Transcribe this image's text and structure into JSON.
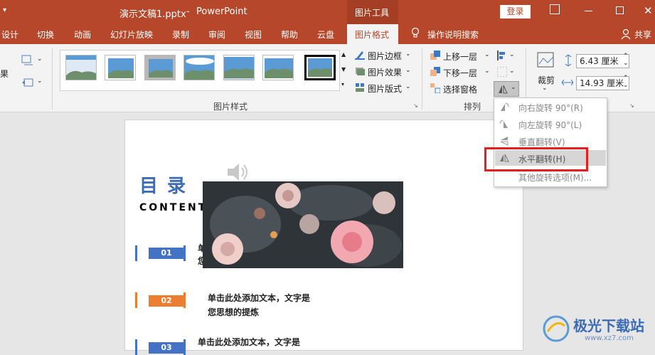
{
  "titlebar": {
    "filename": "演示文稿1.pptx",
    "separator": "-",
    "app": "PowerPoint",
    "context_tab": "图片工具",
    "login": "登录"
  },
  "tabs": [
    "设计",
    "切换",
    "动画",
    "幻灯片放映",
    "录制",
    "审阅",
    "视图",
    "帮助",
    "云盘",
    "图片格式"
  ],
  "tell_me": "操作说明搜索",
  "share": "共享",
  "ribbon": {
    "left_partial": "果",
    "picture_border": "图片边框",
    "picture_effects": "图片效果",
    "picture_layout": "图片版式",
    "styles_group": "图片样式",
    "bring_forward": "上移一层",
    "send_backward": "下移一层",
    "selection_pane": "选择窗格",
    "arrange_group": "排列",
    "crop": "裁剪",
    "height": "6.43 厘米",
    "width": "14.93 厘米"
  },
  "rotate_menu": {
    "items": [
      {
        "label": "向右旋转 90°(R)",
        "icon": "rotate-right-icon"
      },
      {
        "label": "向左旋转 90°(L)",
        "icon": "rotate-left-icon"
      },
      {
        "label": "垂直翻转(V)",
        "icon": "flip-vertical-icon"
      },
      {
        "label": "水平翻转(H)",
        "icon": "flip-horizontal-icon"
      },
      {
        "label": "其他旋转选项(M)...",
        "icon": ""
      }
    ],
    "highlighted_index": 3,
    "highlight_color": "#e81d1d"
  },
  "slide": {
    "title": "目 录",
    "subtitle": "CONTENT",
    "items": [
      {
        "num": "01",
        "text_line1": "单",
        "text_line2": "您",
        "color": "#4472c4"
      },
      {
        "num": "02",
        "text_line1": "单击此处添加文本，文字是",
        "text_line2": "您思想的提炼",
        "color": "#ed7d31"
      },
      {
        "num": "03",
        "text_line1": "单击此处添加文本，文字是",
        "text_line2": "",
        "color": "#4472c4"
      }
    ]
  },
  "watermark": "极光下载站",
  "watermark_url": "www.xz7.com",
  "colors": {
    "accent": "#b7472a",
    "ribbon_bg": "#f3f3f3",
    "menu_highlight_bg": "#d6d6d6"
  }
}
